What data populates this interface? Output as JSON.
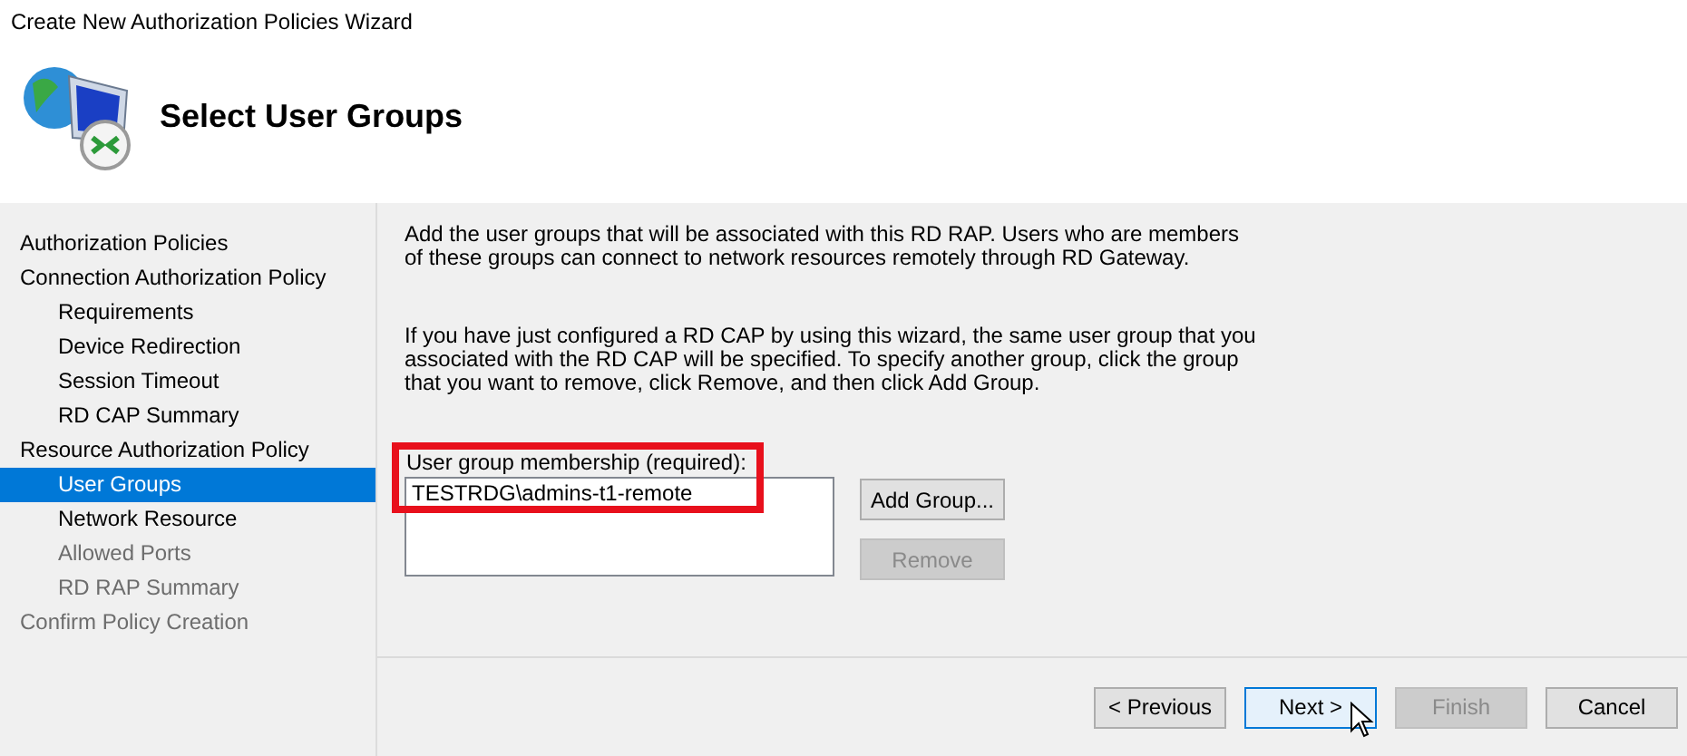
{
  "window": {
    "title": "Create New Authorization Policies Wizard"
  },
  "header": {
    "title": "Select User Groups"
  },
  "nav": [
    {
      "label": "Authorization Policies",
      "selected": false,
      "disabled": false
    },
    {
      "label": "Connection Authorization Policy",
      "selected": false,
      "disabled": false,
      "children": [
        {
          "label": "Requirements",
          "selected": false,
          "disabled": false
        },
        {
          "label": "Device Redirection",
          "selected": false,
          "disabled": false
        },
        {
          "label": "Session Timeout",
          "selected": false,
          "disabled": false
        },
        {
          "label": "RD CAP Summary",
          "selected": false,
          "disabled": false
        }
      ]
    },
    {
      "label": "Resource Authorization Policy",
      "selected": false,
      "disabled": false,
      "children": [
        {
          "label": "User Groups",
          "selected": true,
          "disabled": false
        },
        {
          "label": "Network Resource",
          "selected": false,
          "disabled": false
        },
        {
          "label": "Allowed Ports",
          "selected": false,
          "disabled": true
        },
        {
          "label": "RD RAP Summary",
          "selected": false,
          "disabled": true
        }
      ]
    },
    {
      "label": "Confirm Policy Creation",
      "selected": false,
      "disabled": true
    }
  ],
  "intro": "Add the user groups that will be associated with this RD RAP. Users who are members of these groups can connect to network resources remotely through RD Gateway.",
  "note": "If you have just configured a RD CAP by using this wizard, the same user group that you associated with the RD CAP will be specified. To specify another group, click the group that you want to remove, click Remove, and then click Add Group.",
  "membership": {
    "label": "User group membership (required):",
    "highlighted": true,
    "items": [
      "TESTRDG\\admins-t1-remote"
    ]
  },
  "side_buttons": [
    {
      "label": "Add Group...",
      "disabled": false
    },
    {
      "label": "Remove",
      "disabled": true
    }
  ],
  "footer_buttons": [
    {
      "label": "< Previous",
      "disabled": false,
      "hovered": false
    },
    {
      "label": "Next >",
      "disabled": false,
      "hovered": true
    },
    {
      "label": "Finish",
      "disabled": true,
      "hovered": false
    },
    {
      "label": "Cancel",
      "disabled": false,
      "hovered": false
    }
  ]
}
